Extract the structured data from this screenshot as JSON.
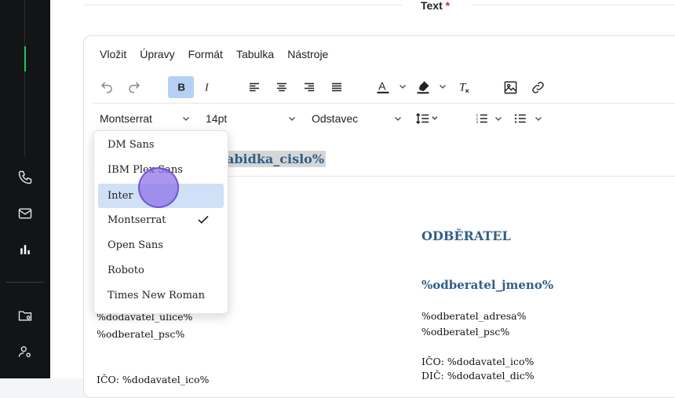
{
  "field": {
    "label": "Text",
    "required_mark": "*"
  },
  "menu": [
    "Vložit",
    "Úpravy",
    "Formát",
    "Tabulka",
    "Nástroje"
  ],
  "toolbar": {
    "font_family": "Montserrat",
    "font_size": "14pt",
    "block_format": "Odstavec"
  },
  "font_dropdown": {
    "options": [
      "DM Sans",
      "IBM Plex Sans",
      "Inter",
      "Montserrat",
      "Open Sans",
      "Roboto",
      "Times New Roman"
    ],
    "selected": "Montserrat",
    "hovered": "Inter"
  },
  "document": {
    "selected_text": "abidka_cislo%",
    "customer_heading": "ODBĚRATEL",
    "customer_name": "%odberatel_jmeno%",
    "left_lines": [
      "%dodavatel_ulice%",
      "%odberatel_psc%",
      "IČO: %dodavatel_ico%"
    ],
    "right_lines": [
      "%odberatel_adresa%",
      "%odberatel_psc%",
      "IČO: %dodavatel_ico%",
      "DIČ: %dodavatel_dic%"
    ]
  },
  "colors": {
    "accent_active": "#22c55e",
    "heading": "#2e5f8a",
    "hover": "#cfe0f7",
    "bold_active": "#b4d1f5"
  }
}
